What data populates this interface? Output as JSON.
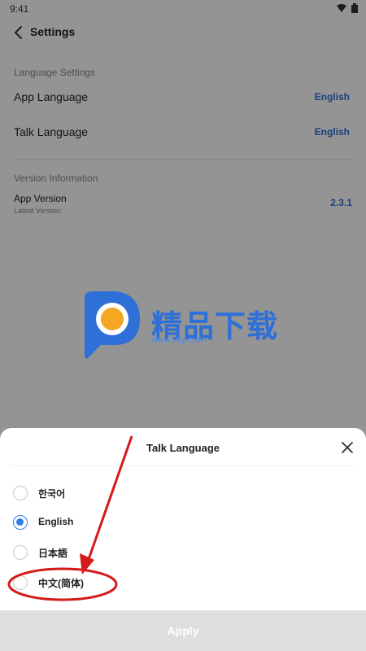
{
  "status_bar": {
    "time": "9:41",
    "icons": [
      "wifi-icon",
      "battery-icon"
    ]
  },
  "header": {
    "title": "Settings",
    "back_icon": "chevron-left-icon"
  },
  "language_settings": {
    "section": "Language Settings",
    "app_language": {
      "label": "App Language",
      "value": "English"
    },
    "talk_language": {
      "label": "Talk Language",
      "value": "English"
    }
  },
  "version_info": {
    "section": "Version Information",
    "app_version": {
      "label": "App Version",
      "sublabel": "Latest Version:",
      "value": "2.3.1"
    }
  },
  "watermark": {
    "text": "精品下载",
    "url": "www.J9p.com"
  },
  "sheet": {
    "title": "Talk Language",
    "close_icon": "close-icon",
    "options": [
      {
        "label": "한국어",
        "selected": false
      },
      {
        "label": "English",
        "selected": true
      },
      {
        "label": "日本語",
        "selected": false
      },
      {
        "label": "中文(简体)",
        "selected": false
      }
    ],
    "apply_label": "Apply"
  },
  "colors": {
    "accent": "#2f7fe8",
    "value_text": "#2f6fd6",
    "annotation": "#d61a1a",
    "apply_bg": "#dedede"
  }
}
